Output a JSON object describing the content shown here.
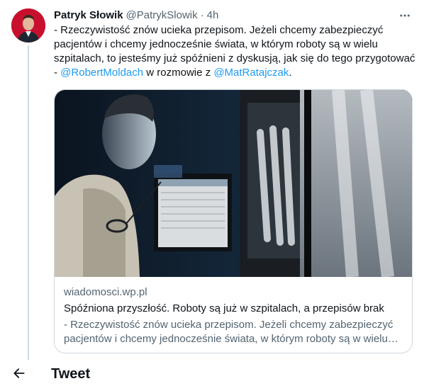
{
  "tweet": {
    "author_name": "Patryk Słowik",
    "author_handle": "@PatrykSlowik",
    "separator": "·",
    "time": "4h",
    "text_part1": "- Rzeczywistość znów ucieka przepisom. Jeżeli chcemy zabezpieczyć pacjentów i chcemy jednocześnie świata, w którym roboty są w wielu szpitalach, to jesteśmy już spóźnieni z dyskusją, jak się do tego przygotować - ",
    "mention1": "@RobertMoldach",
    "text_part2": " w rozmowie z ",
    "mention2": "@MatRatajczak",
    "text_part3": "."
  },
  "card": {
    "domain": "wiadomosci.wp.pl",
    "title": "Spóźniona przyszłość. Roboty są już w szpitalach, a przepisów brak",
    "description": "- Rzeczywistość znów ucieka przepisom. Jeżeli chcemy zabezpieczyć pacjentów i chcemy jednocześnie świata, w którym roboty są w wielu szpitalach, to jesteśmy już spóźnieni z dyskusją..."
  },
  "nav": {
    "title": "Tweet"
  },
  "icons": {
    "more": "more-horizontal-icon",
    "back": "arrow-left-icon"
  },
  "colors": {
    "mention": "#1d9bf0",
    "secondary_text": "#536471",
    "border": "#cfd9de",
    "avatar_bg": "#c8102e"
  }
}
